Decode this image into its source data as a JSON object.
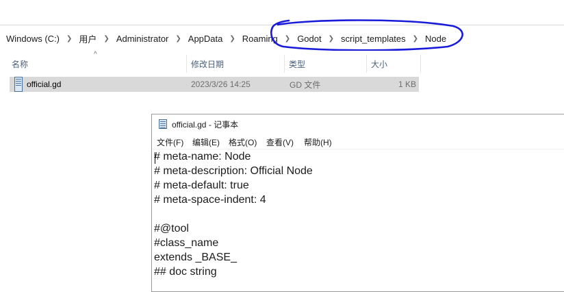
{
  "address": {
    "crumbs": [
      "Windows (C:)",
      "用户",
      "Administrator",
      "AppData",
      "Roaming",
      "Godot",
      "script_templates",
      "Node"
    ]
  },
  "columns": {
    "name": "名称",
    "modified": "修改日期",
    "type": "类型",
    "size": "大小"
  },
  "file": {
    "name": "official.gd",
    "modified": "2023/3/26 14:25",
    "type": "GD 文件",
    "size": "1 KB"
  },
  "notepad": {
    "title": "official.gd - 记事本",
    "menu": [
      "文件(F)",
      "编辑(E)",
      "格式(O)",
      "查看(V)",
      "帮助(H)"
    ],
    "lines": [
      "# meta-name: Node",
      "# meta-description: Official Node",
      "# meta-default: true",
      "# meta-space-indent: 4",
      "",
      "#@tool",
      "#class_name",
      "extends _BASE_",
      "## doc string"
    ]
  },
  "colors": {
    "annotation": "#1a1adb",
    "selection": "#d9d9d9",
    "column_header_text": "#4c607a"
  }
}
